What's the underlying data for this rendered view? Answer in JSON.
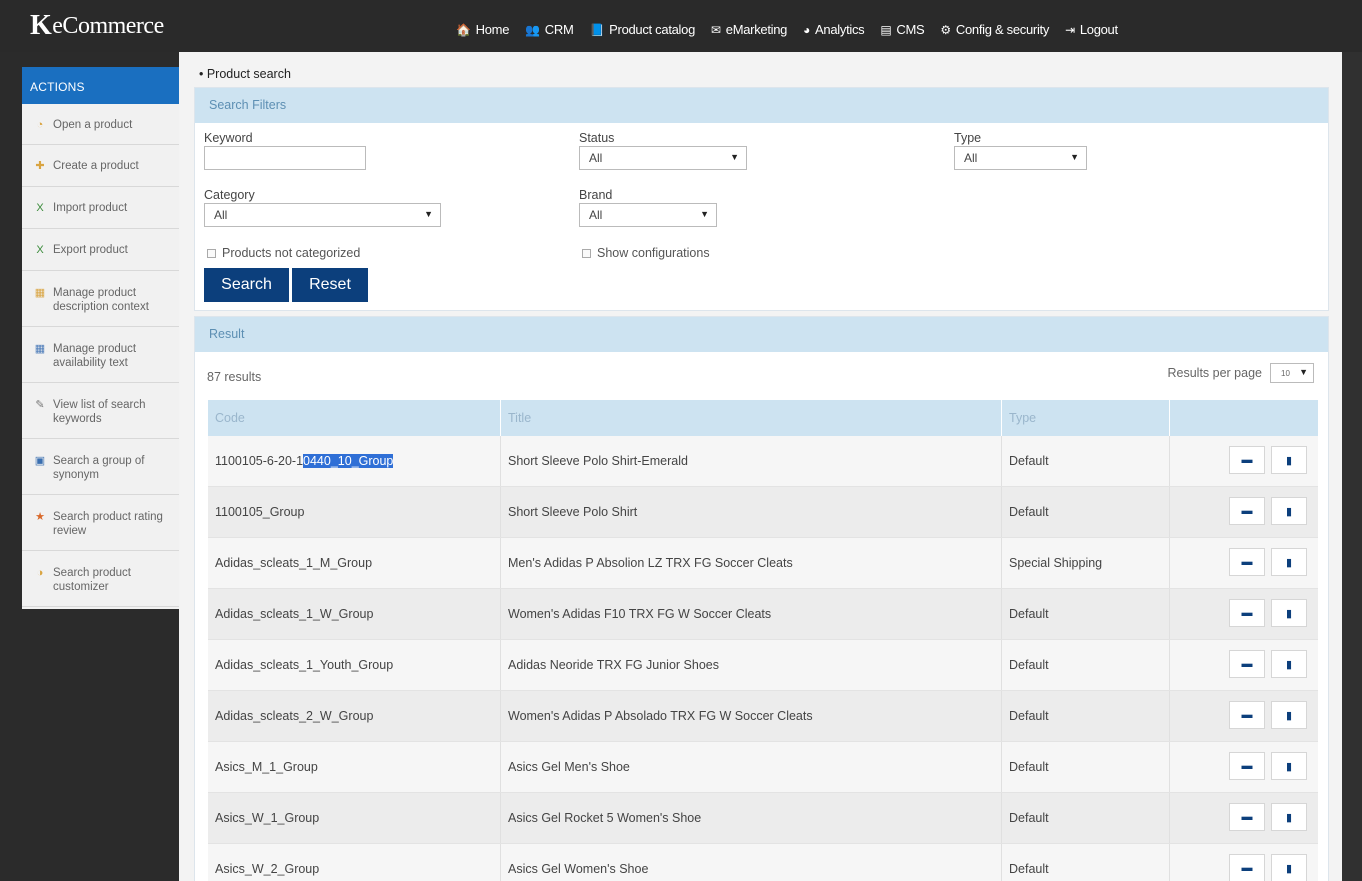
{
  "brand": {
    "logo_mark": "K",
    "logo_text": "eCommerce"
  },
  "nav": [
    {
      "icon": "home-icon",
      "glyph": "🏠",
      "label": "Home"
    },
    {
      "icon": "users-icon",
      "glyph": "👥",
      "label": "CRM"
    },
    {
      "icon": "book-icon",
      "glyph": "📘",
      "label": "Product catalog"
    },
    {
      "icon": "envelope-icon",
      "glyph": "✉",
      "label": "eMarketing"
    },
    {
      "icon": "pie-chart-icon",
      "glyph": "◕",
      "label": "Analytics"
    },
    {
      "icon": "document-icon",
      "glyph": "▤",
      "label": "CMS"
    },
    {
      "icon": "gear-icon",
      "glyph": "⚙",
      "label": "Config & security"
    },
    {
      "icon": "logout-icon",
      "glyph": "⇥",
      "label": "Logout"
    }
  ],
  "sidebar": {
    "header": "ACTIONS",
    "items": [
      {
        "label": "Open a product",
        "icon": "open-product-icon",
        "glyph": "◔",
        "color": "#d9a441"
      },
      {
        "label": "Create a product",
        "icon": "create-product-icon",
        "glyph": "✚",
        "color": "#d9a441"
      },
      {
        "label": "Import product",
        "icon": "excel-icon",
        "glyph": "X",
        "color": "#3c8c3c"
      },
      {
        "label": "Export product",
        "icon": "excel-icon",
        "glyph": "X",
        "color": "#3c8c3c"
      },
      {
        "label": "Manage product description context",
        "icon": "context-icon",
        "glyph": "▦",
        "color": "#d9a441"
      },
      {
        "label": "Manage product availability text",
        "icon": "availability-icon",
        "glyph": "▦",
        "color": "#4a7ab8"
      },
      {
        "label": "View list of search keywords",
        "icon": "keywords-icon",
        "glyph": "✎",
        "color": "#777777"
      },
      {
        "label": "Search a group of synonym",
        "icon": "synonym-icon",
        "glyph": "▣",
        "color": "#3a6fb0"
      },
      {
        "label": "Search product rating review",
        "icon": "star-icon",
        "glyph": "★",
        "color": "#d9692a"
      },
      {
        "label": "Search product customizer",
        "icon": "customizer-icon",
        "glyph": "◑",
        "color": "#d9a441"
      }
    ]
  },
  "breadcrumb": "• Product search",
  "filters": {
    "title": "Search Filters",
    "keyword_label": "Keyword",
    "keyword_value": "",
    "status_label": "Status",
    "status_value": "All",
    "type_label": "Type",
    "type_value": "All",
    "category_label": "Category",
    "category_value": "All",
    "brand_label": "Brand",
    "brand_value": "All",
    "not_categorized_label": "Products not categorized",
    "show_configurations_label": "Show configurations",
    "search_button": "Search",
    "reset_button": "Reset"
  },
  "result": {
    "title": "Result",
    "count": "87 results",
    "per_page_label": "Results per page",
    "per_page_value": "10",
    "columns": {
      "code": "Code",
      "title": "Title",
      "type": "Type"
    },
    "rows": [
      {
        "code_pre": "1100105-6-20-1",
        "code_sel": "0440_10_Group",
        "title": "Short Sleeve Polo Shirt-Emerald",
        "type": "Default"
      },
      {
        "code_pre": "1100105_Group",
        "code_sel": "",
        "title": "Short Sleeve Polo Shirt",
        "type": "Default"
      },
      {
        "code_pre": "Adidas_scleats_1_M_Group",
        "code_sel": "",
        "title": "Men's Adidas P Absolion LZ TRX FG Soccer Cleats",
        "type": "Special Shipping"
      },
      {
        "code_pre": "Adidas_scleats_1_W_Group",
        "code_sel": "",
        "title": "Women's Adidas F10 TRX FG W Soccer Cleats",
        "type": "Default"
      },
      {
        "code_pre": "Adidas_scleats_1_Youth_Group",
        "code_sel": "",
        "title": "Adidas Neoride TRX FG Junior Shoes",
        "type": "Default"
      },
      {
        "code_pre": "Adidas_scleats_2_W_Group",
        "code_sel": "",
        "title": "Women's Adidas P Absolado TRX FG W Soccer Cleats",
        "type": "Default"
      },
      {
        "code_pre": "Asics_M_1_Group",
        "code_sel": "",
        "title": "Asics Gel Men's Shoe",
        "type": "Default"
      },
      {
        "code_pre": "Asics_W_1_Group",
        "code_sel": "",
        "title": "Asics Gel Rocket 5 Women's Shoe",
        "type": "Default"
      },
      {
        "code_pre": "Asics_W_2_Group",
        "code_sel": "",
        "title": "Asics Gel Women's Shoe",
        "type": "Default"
      }
    ],
    "action_icons": {
      "open": "folder-icon",
      "delete": "trash-icon"
    }
  }
}
